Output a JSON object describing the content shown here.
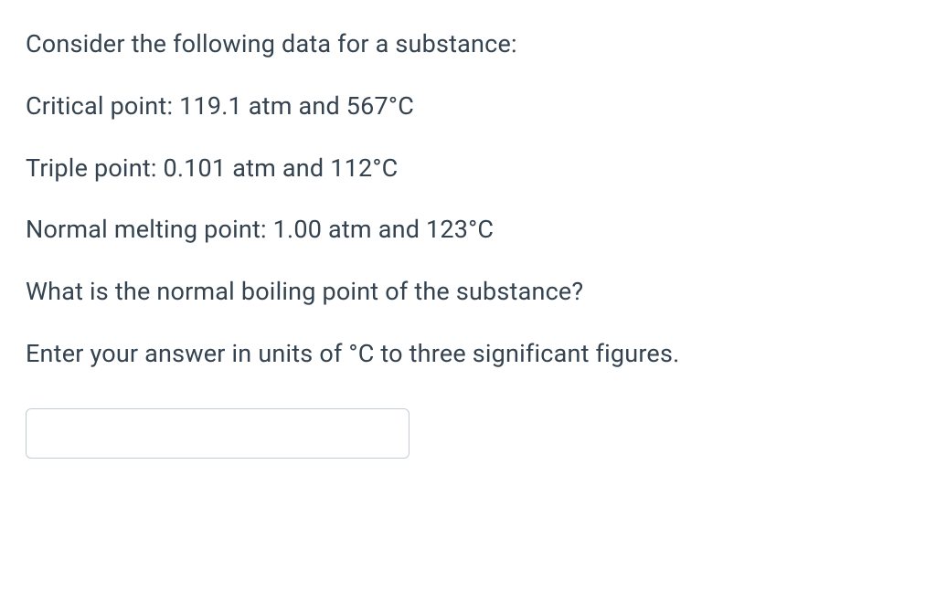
{
  "question": {
    "intro": "Consider the following data for a substance:",
    "critical_point": "Critical point: 119.1 atm and 567°C",
    "triple_point": "Triple point: 0.101 atm and 112°C",
    "melting_point": "Normal melting point: 1.00 atm and 123°C",
    "prompt": "What is the normal boiling point of the substance?",
    "instructions": "Enter your answer in units of °C to three significant figures."
  },
  "answer": {
    "value": ""
  }
}
